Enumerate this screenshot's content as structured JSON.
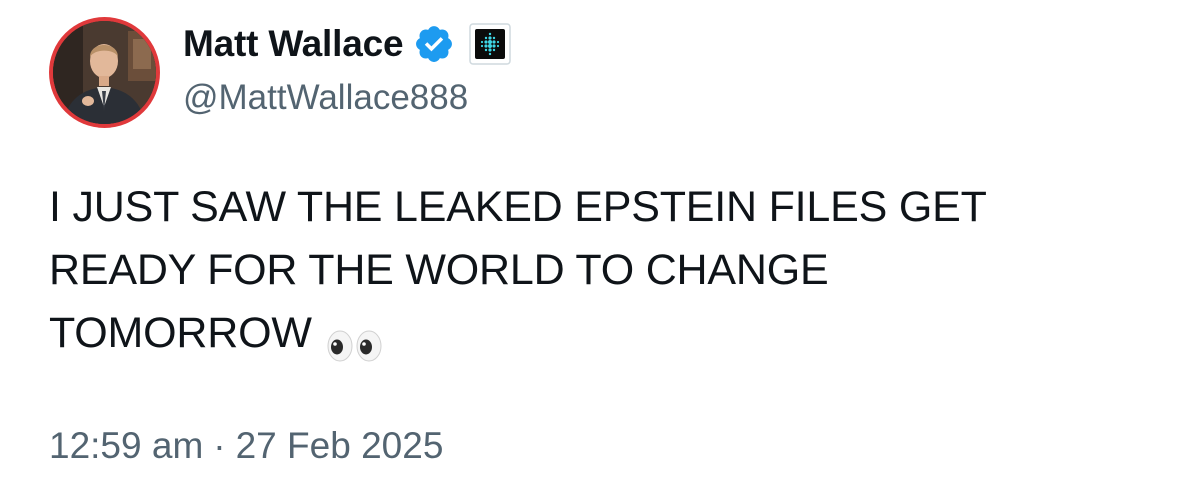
{
  "author": {
    "display_name": "Matt Wallace",
    "handle": "@MattWallace888",
    "verified": true,
    "avatar": "profile-photo",
    "affiliate_badge": "affiliate-badge-icon"
  },
  "tweet": {
    "lines": [
      "I JUST SAW THE LEAKED EPSTEIN FILES GET",
      "READY FOR THE WORLD TO CHANGE",
      "TOMORROW"
    ],
    "emoji": "eyes-icon"
  },
  "meta": {
    "time": "12:59 am",
    "separator": "·",
    "date": "27 Feb 2025"
  },
  "colors": {
    "verified": "#1d9bf0",
    "secondary_text": "#536471",
    "primary_text": "#0f1419",
    "avatar_ring": "#e0393b"
  }
}
